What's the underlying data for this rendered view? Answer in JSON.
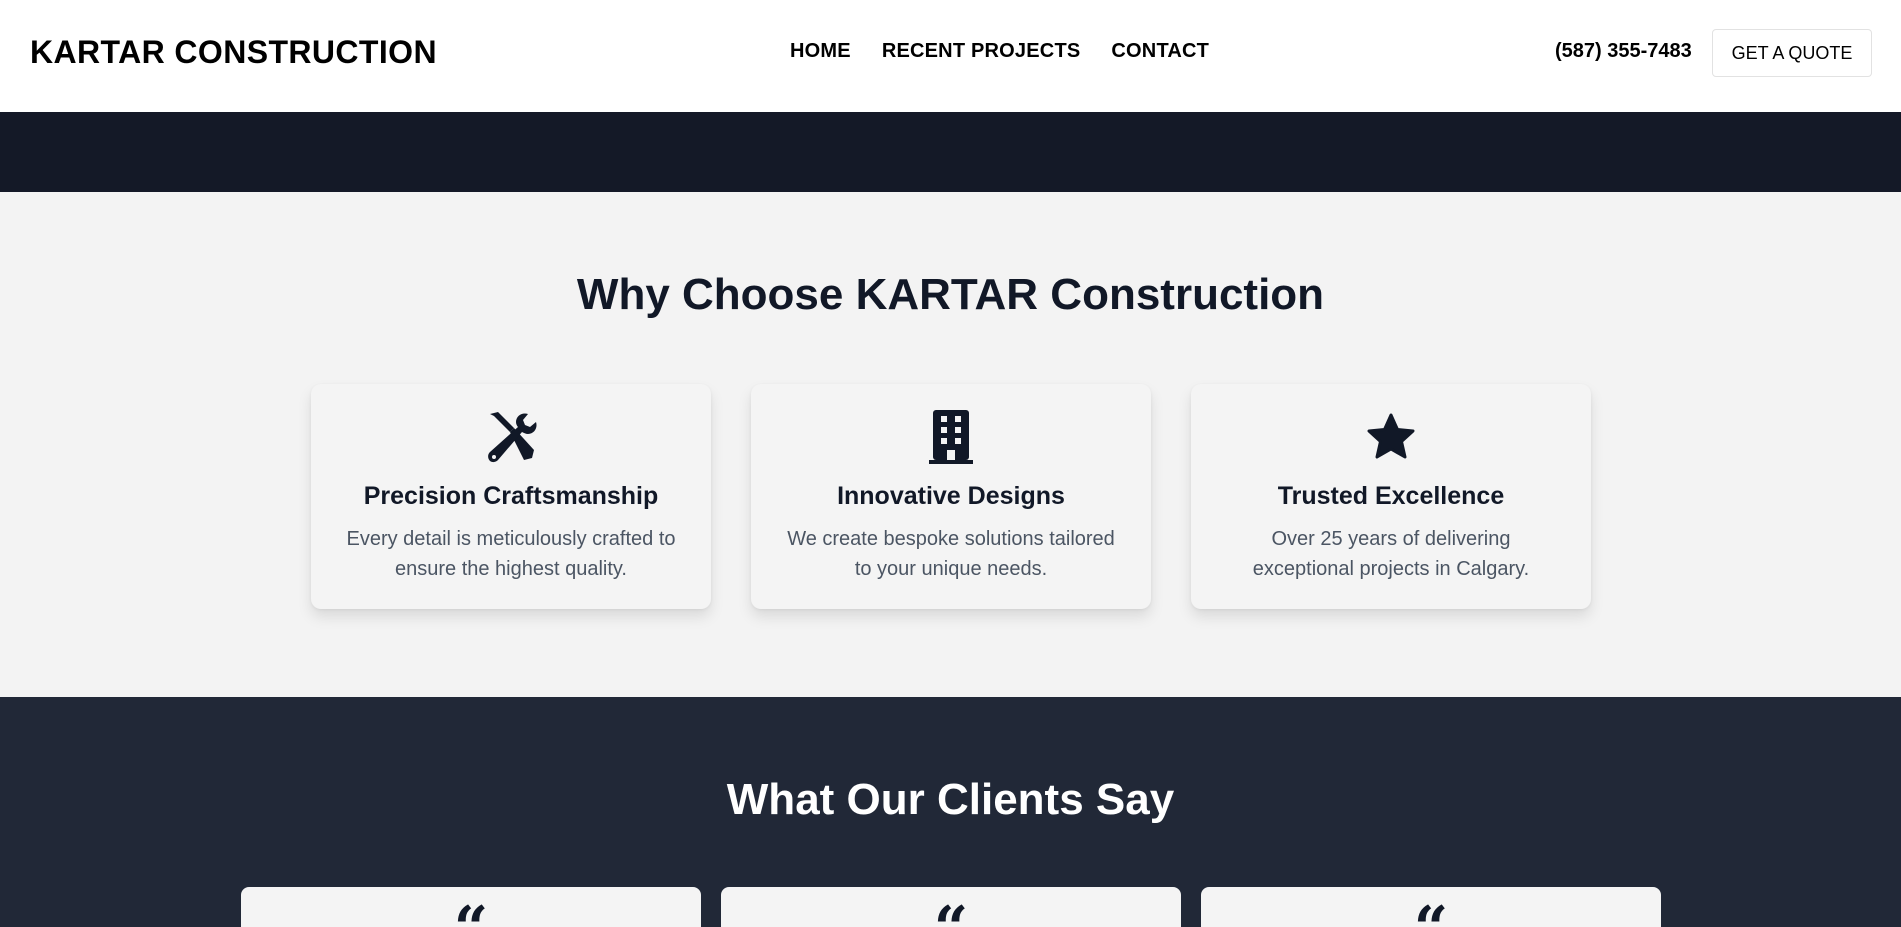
{
  "header": {
    "logo": "KARTAR CONSTRUCTION",
    "nav": [
      "HOME",
      "RECENT PROJECTS",
      "CONTACT"
    ],
    "phone": "(587) 355-7483",
    "cta": "GET A QUOTE"
  },
  "why": {
    "title": "Why Choose KARTAR Construction",
    "features": [
      {
        "icon": "tools-icon",
        "title": "Precision Craftsmanship",
        "text": "Every detail is meticulously crafted to ensure the highest quality."
      },
      {
        "icon": "building-icon",
        "title": "Innovative Designs",
        "text": "We create bespoke solutions tailored to your unique needs."
      },
      {
        "icon": "star-icon",
        "title": "Trusted Excellence",
        "text": "Over 25 years of delivering exceptional projects in Calgary."
      }
    ]
  },
  "clients": {
    "title": "What Our Clients Say",
    "quote_mark": "“"
  },
  "colors": {
    "dark_navy": "#141927",
    "section_dark": "#212837",
    "light_bg": "#f3f3f3",
    "text_dark": "#111827",
    "text_muted": "#4b5563"
  }
}
